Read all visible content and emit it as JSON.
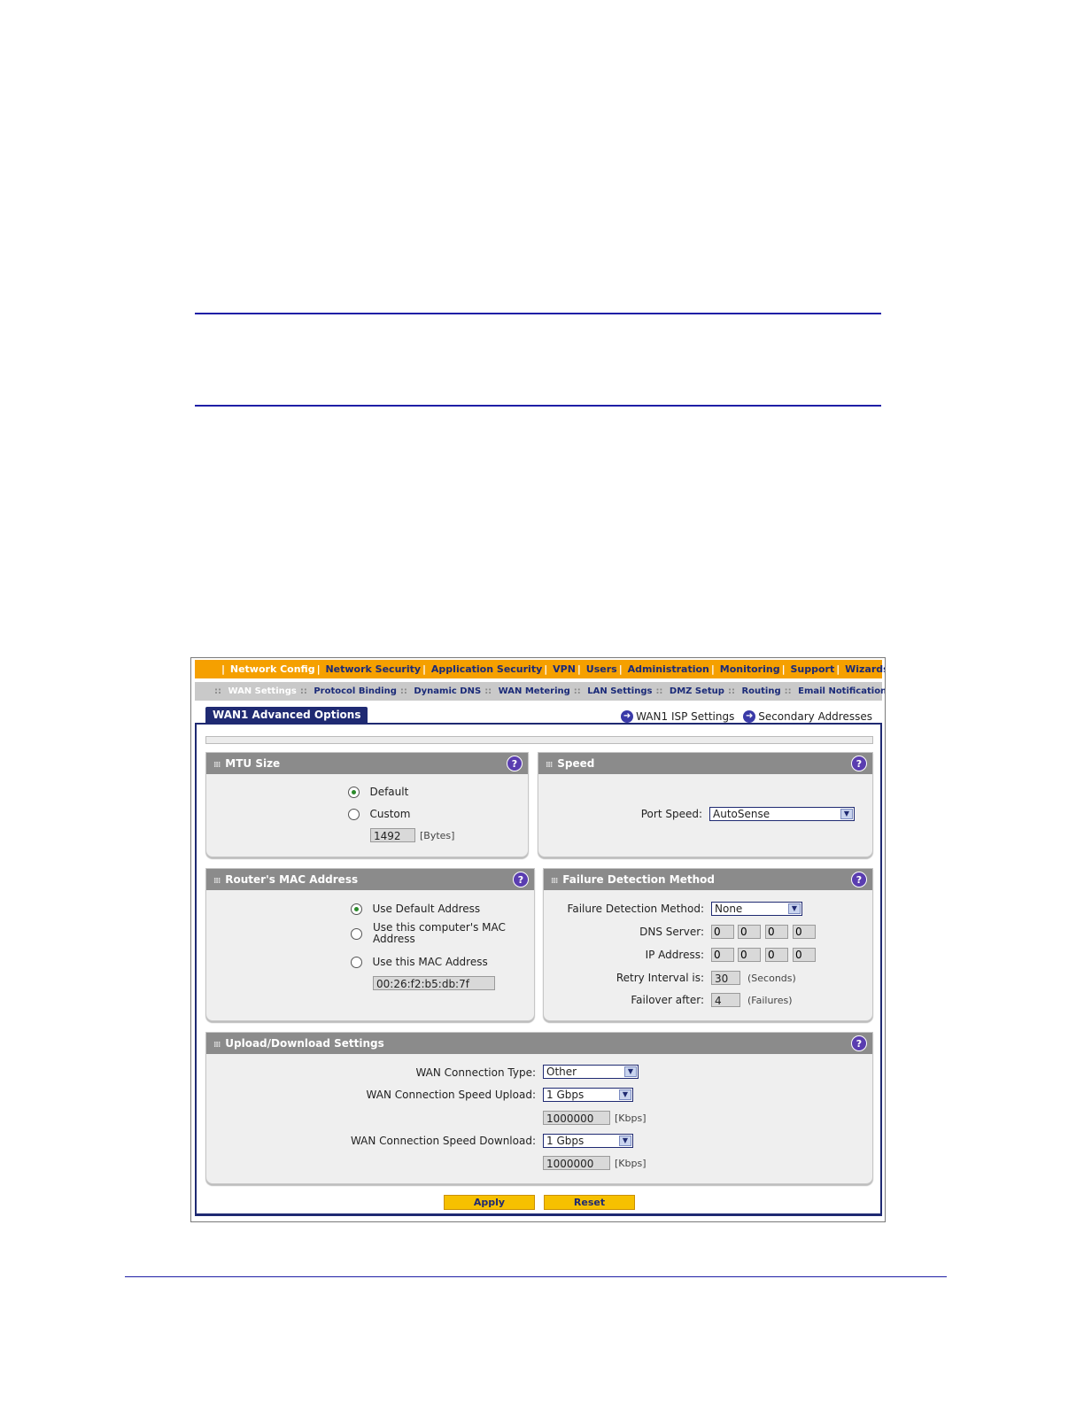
{
  "nav": {
    "items": [
      "Network Config",
      "Network Security",
      "Application Security",
      "VPN",
      "Users",
      "Administration",
      "Monitoring",
      "Support",
      "Wizards"
    ]
  },
  "subnav": {
    "items": [
      "WAN Settings",
      "Protocol Binding",
      "Dynamic DNS",
      "WAN Metering",
      "LAN Settings",
      "DMZ Setup",
      "Routing",
      "Email Notification"
    ]
  },
  "tab": {
    "label": "WAN1 Advanced Options"
  },
  "links": {
    "isp": "WAN1 ISP Settings",
    "secondary": "Secondary Addresses"
  },
  "mtu": {
    "title": "MTU Size",
    "default_label": "Default",
    "custom_label": "Custom",
    "value": "1492",
    "unit": "[Bytes]",
    "selected": "Default"
  },
  "speed": {
    "title": "Speed",
    "port_speed_label": "Port Speed:",
    "port_speed_value": "AutoSense"
  },
  "mac": {
    "title": "Router's MAC Address",
    "opt1": "Use Default Address",
    "opt2": "Use this computer's MAC Address",
    "opt2_line1": "Use this computer's MAC",
    "opt2_line2": "Address",
    "opt3": "Use this MAC Address",
    "value": "00:26:f2:b5:db:7f",
    "selected": "Use Default Address"
  },
  "failure": {
    "title": "Failure Detection Method",
    "method_label": "Failure Detection Method:",
    "method_value": "None",
    "dns_label": "DNS Server:",
    "dns": [
      "0",
      "0",
      "0",
      "0"
    ],
    "ip_label": "IP Address:",
    "ip": [
      "0",
      "0",
      "0",
      "0"
    ],
    "retry_label": "Retry Interval is:",
    "retry_value": "30",
    "retry_unit": "(Seconds)",
    "failover_label": "Failover after:",
    "failover_value": "4",
    "failover_unit": "(Failures)"
  },
  "updown": {
    "title": "Upload/Download Settings",
    "type_label": "WAN Connection Type:",
    "type_value": "Other",
    "upload_label": "WAN Connection Speed Upload:",
    "upload_value": "1 Gbps",
    "upload_kbps": "1000000",
    "download_label": "WAN Connection Speed Download:",
    "download_value": "1 Gbps",
    "download_kbps": "1000000",
    "unit": "[Kbps]"
  },
  "buttons": {
    "apply": "Apply",
    "reset": "Reset"
  },
  "colors": {
    "nav_bg": "#f5a000",
    "tab_bg": "#1f2a72",
    "button_bg": "#f6c000",
    "rule": "#1f1fa6"
  }
}
